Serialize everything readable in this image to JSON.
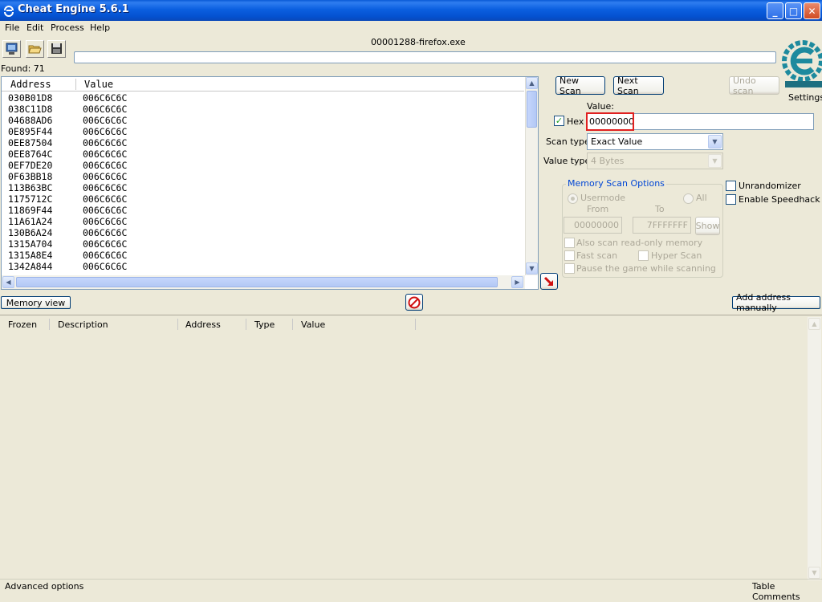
{
  "window": {
    "title": "Cheat Engine 5.6.1"
  },
  "menu": [
    "File",
    "Edit",
    "Process",
    "Help"
  ],
  "process": {
    "name": "00001288-firefox.exe"
  },
  "found": {
    "label": "Found: 71"
  },
  "found_list": {
    "columns": [
      "Address",
      "Value"
    ],
    "rows": [
      {
        "address": "030B01D8",
        "value": "006C6C6C"
      },
      {
        "address": "038C11D8",
        "value": "006C6C6C"
      },
      {
        "address": "04688AD6",
        "value": "006C6C6C"
      },
      {
        "address": "0E895F44",
        "value": "006C6C6C"
      },
      {
        "address": "0EE87504",
        "value": "006C6C6C"
      },
      {
        "address": "0EE8764C",
        "value": "006C6C6C"
      },
      {
        "address": "0EF7DE20",
        "value": "006C6C6C"
      },
      {
        "address": "0F63BB18",
        "value": "006C6C6C"
      },
      {
        "address": "113B63BC",
        "value": "006C6C6C"
      },
      {
        "address": "1175712C",
        "value": "006C6C6C"
      },
      {
        "address": "11869F44",
        "value": "006C6C6C"
      },
      {
        "address": "11A61A24",
        "value": "006C6C6C"
      },
      {
        "address": "130B6A24",
        "value": "006C6C6C"
      },
      {
        "address": "1315A704",
        "value": "006C6C6C"
      },
      {
        "address": "1315A8E4",
        "value": "006C6C6C"
      },
      {
        "address": "1342A844",
        "value": "006C6C6C"
      }
    ]
  },
  "scan": {
    "new_scan": "New Scan",
    "next_scan": "Next Scan",
    "undo_scan": "Undo scan",
    "settings": "Settings",
    "value_label": "Value:",
    "hex_label": "Hex",
    "hex_checked": true,
    "value": "00000000",
    "scan_type_label": "Scan type",
    "scan_type": "Exact Value",
    "value_type_label": "Value type",
    "value_type": "4 Bytes"
  },
  "memory_options": {
    "title": "Memory Scan Options",
    "usermode": "Usermode",
    "all": "All",
    "from_label": "From",
    "to_label": "To",
    "from": "00000000",
    "to": "7FFFFFFF",
    "show": "Show",
    "read_only": "Also scan read-only memory",
    "fast_scan": "Fast scan",
    "hyper_scan": "Hyper Scan",
    "pause": "Pause the game while scanning"
  },
  "extras": {
    "unrandomizer": "Unrandomizer",
    "speedhack": "Enable Speedhack"
  },
  "actions": {
    "memory_view": "Memory view",
    "add_address": "Add address manually"
  },
  "address_table": {
    "columns": [
      "Frozen",
      "Description",
      "Address",
      "Type",
      "Value"
    ]
  },
  "status": {
    "advanced": "Advanced options",
    "comments": "Table Comments"
  },
  "colors": {
    "title_blue": "#0451d0",
    "highlight_red": "#e02020",
    "logo_teal": "#1d8a9e"
  }
}
